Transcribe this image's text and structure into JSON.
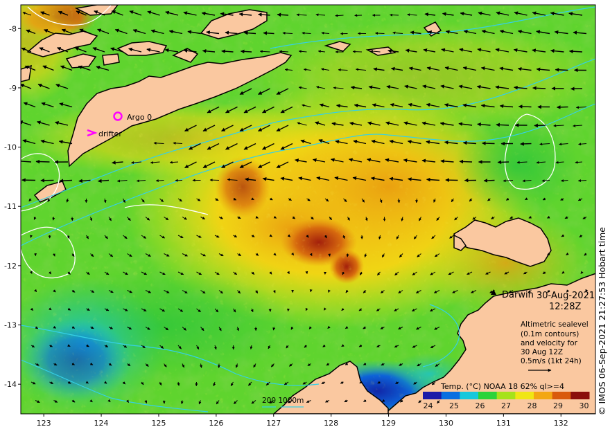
{
  "map": {
    "lon_ticks": [
      "123",
      "124",
      "125",
      "126",
      "127",
      "128",
      "129",
      "130",
      "131",
      "132"
    ],
    "lat_ticks": [
      "-8",
      "-9",
      "-10",
      "-11",
      "-12",
      "-13",
      "-14"
    ],
    "lon_range": [
      122.6,
      132.6
    ],
    "lat_range": [
      -14.5,
      -7.6
    ]
  },
  "labels": {
    "argo": "Argo 0",
    "drifter": "drifter",
    "city": "Darwin",
    "date": "30-Aug-2021",
    "time": "12:28Z"
  },
  "legend_text": {
    "line1": "Altimetric sealevel",
    "line2": "(0.1m contours)",
    "line3": "and velocity for",
    "line4": "30 Aug 12Z",
    "line5": "0.5m/s (1kt 24h)"
  },
  "depth_legend": "200 1000m",
  "colorbar": {
    "title": "Temp. (°C) NOAA 18 62% ql>=4",
    "ticks": [
      "24",
      "25",
      "26",
      "27",
      "28",
      "29",
      "30"
    ],
    "stops": [
      "#1b1aa8",
      "#0a6ee0",
      "#17c8dc",
      "#2bd33a",
      "#a6e21a",
      "#f0e614",
      "#f3a713",
      "#d95a0c",
      "#8a0e0b"
    ]
  },
  "credit": "© IMOS 06-Sep-2021 21:27:53 Hobart time",
  "colors": {
    "land": "#fac8a0",
    "contour_white": "#ffffff",
    "contour_cyan": "#35d0e6",
    "argo_marker": "#ff00ff",
    "drifter_marker": "#ff00ff",
    "arrow": "#000000"
  }
}
